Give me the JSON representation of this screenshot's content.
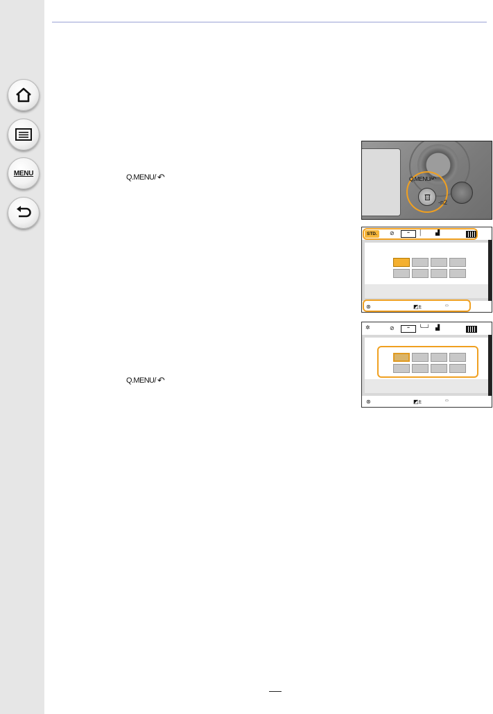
{
  "nav": {
    "home_icon": "home-icon",
    "contents_icon": "list-icon",
    "menu_label": "MENU",
    "back_icon": "back-arrow-icon"
  },
  "instructions": {
    "step_button_1": "Q.MENU/",
    "step_button_2": "Q.MENU/",
    "arrow_glyph": "↶"
  },
  "camera_photo": {
    "button_label": "Q.MENU/",
    "model_fragment": "-n2",
    "highlight_color": "#f0a020"
  },
  "screen1": {
    "mode_badge": "STD."
  },
  "colors": {
    "accent": "#f0a020",
    "sidebar": "#e6e6e6",
    "rule": "#c9cde8"
  }
}
